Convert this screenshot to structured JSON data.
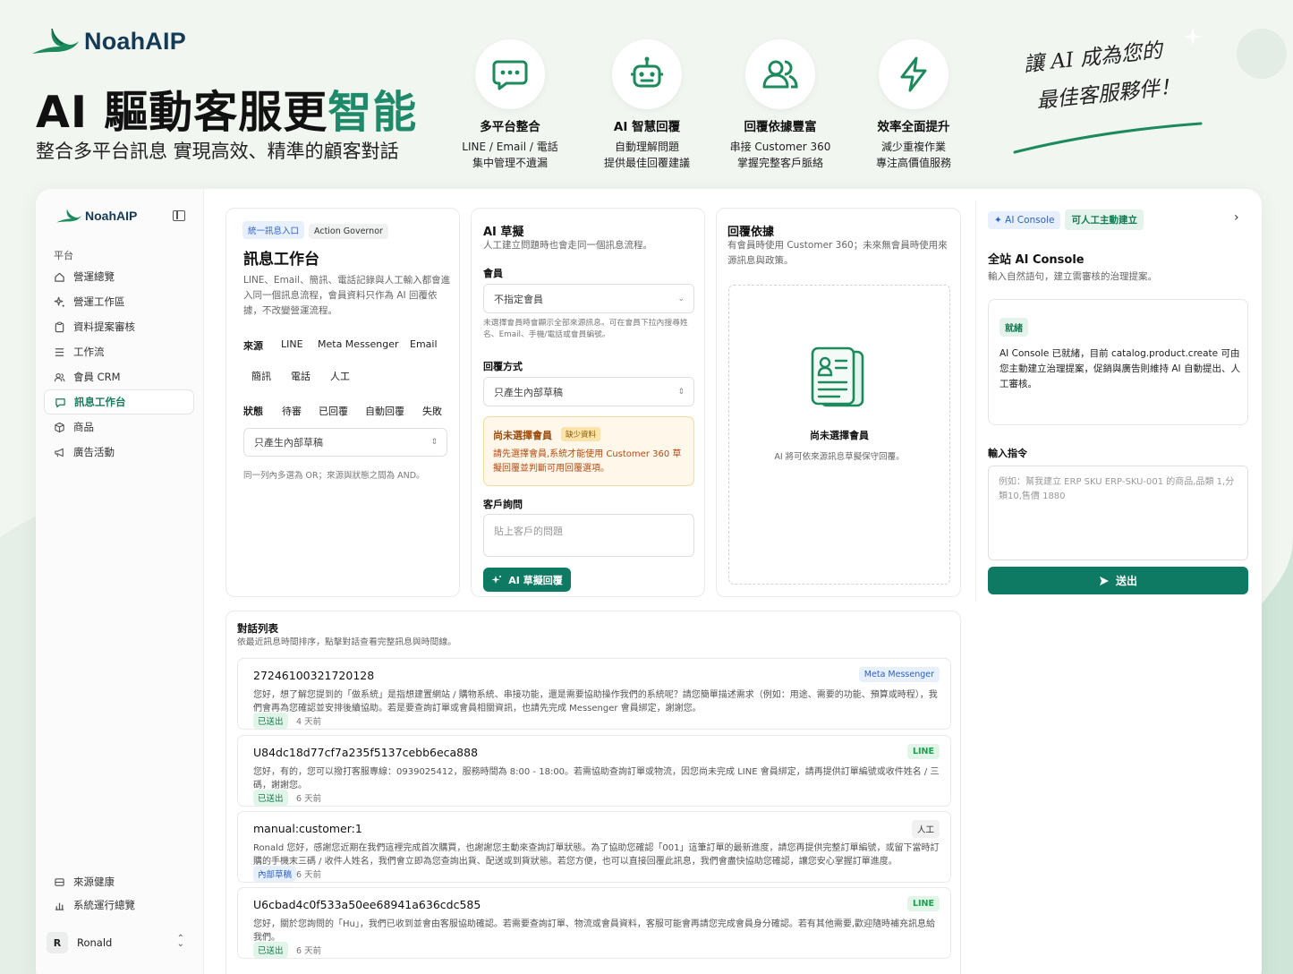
{
  "brand": {
    "logo_text": "NoahAIP"
  },
  "hero": {
    "headline_main": "AI 驅動客服更",
    "headline_accent": "智能",
    "subline": "整合多平台訊息 實現高效、精準的顧客對話",
    "tagline_line1": "讓 AI 成為您的",
    "tagline_line2": "最佳客服夥伴！",
    "features": [
      {
        "icon": "chat-bubble-icon",
        "title": "多平台整合",
        "line1": "LINE / Email / 電話",
        "line2": "集中管理不遺漏"
      },
      {
        "icon": "robot-icon",
        "title": "AI 智慧回覆",
        "line1": "自動理解問題",
        "line2": "提供最佳回覆建議"
      },
      {
        "icon": "users-icon",
        "title": "回覆依據豐富",
        "line1": "串接 Customer 360",
        "line2": "掌握完整客戶脈絡"
      },
      {
        "icon": "lightning-icon",
        "title": "效率全面提升",
        "line1": "減少重複作業",
        "line2": "專注高價值服務"
      }
    ]
  },
  "sidebar": {
    "logo_text": "NoahAIP",
    "section": "平台",
    "items": [
      {
        "label": "營運總覽",
        "icon": "home-icon"
      },
      {
        "label": "營運工作區",
        "icon": "sparkle-icon"
      },
      {
        "label": "資料提案審核",
        "icon": "clipboard-icon"
      },
      {
        "label": "工作流",
        "icon": "list-icon"
      },
      {
        "label": "會員 CRM",
        "icon": "users-icon"
      },
      {
        "label": "訊息工作台",
        "icon": "message-icon"
      },
      {
        "label": "商品",
        "icon": "box-icon"
      },
      {
        "label": "廣告活動",
        "icon": "megaphone-icon"
      }
    ],
    "active_index": 5,
    "bottom_items": [
      {
        "label": "來源健康",
        "icon": "database-icon"
      },
      {
        "label": "系統運行總覽",
        "icon": "bar-chart-icon"
      }
    ],
    "user": {
      "initial": "R",
      "name": "Ronald"
    }
  },
  "workbench": {
    "tag1": "統一訊息入口",
    "tag2": "Action Governor",
    "title": "訊息工作台",
    "desc": "LINE、Email、簡訊、電話記錄與人工輸入都會進入同一個訊息流程，會員資料只作為 AI 回覆依據，不改變營運流程。",
    "source_label": "來源",
    "sources": [
      "LINE",
      "Meta Messenger",
      "Email",
      "簡訊",
      "電話",
      "人工"
    ],
    "status_label": "狀態",
    "statuses": [
      "待審",
      "已回覆",
      "自動回覆",
      "失敗"
    ],
    "filter_value": "只產生內部草稿",
    "note": "同一列內多選為 OR；來源與狀態之間為 AND。"
  },
  "draft": {
    "title": "AI 草擬",
    "desc": "人工建立問題時也會走同一個訊息流程。",
    "member_label": "會員",
    "member_value": "不指定會員",
    "member_note": "未選擇會員時會顯示全部來源訊息。可在會員下拉內搜尋姓名、Email、手機/電話或會員編號。",
    "reply_label": "回覆方式",
    "reply_value": "只產生內部草稿",
    "warn_title": "尚未選擇會員",
    "warn_badge": "缺少資料",
    "warn_text": "請先選擇會員,系統才能使用 Customer 360 草擬回覆並判斷可用回覆選項。",
    "question_label": "客戶詢問",
    "question_placeholder": "貼上客戶的問題",
    "button": "AI 草擬回覆"
  },
  "basis": {
    "title": "回覆依據",
    "desc": "有會員時使用 Customer 360；未來無會員時使用來源訊息與政策。",
    "empty_title": "尚未選擇會員",
    "empty_desc": "AI 將可依來源訊息草擬保守回覆。"
  },
  "console": {
    "tag1": "AI Console",
    "tag2": "可人工主動建立",
    "title": "全站 AI Console",
    "desc": "輸入自然語句，建立需審核的治理提案。",
    "status": "就緒",
    "status_text": "AI Console 已就緒，目前 catalog.product.create 可由您主動建立治理提案，促銷與廣告則維持 AI 自動提出、人工審核。",
    "input_label": "輸入指令",
    "input_placeholder": "例如：幫我建立 ERP SKU ERP-SKU-001 的商品,品類 1,分類10,售價 1880",
    "send": "送出"
  },
  "conversations": {
    "title": "對話列表",
    "desc": "依最近訊息時間排序，點擊對話查看完整訊息與時間線。",
    "items": [
      {
        "id": "27246100321720128",
        "channel": "Meta Messenger",
        "channel_type": "meta",
        "message": "您好，想了解您提到的「做系統」是指想建置網站 / 購物系統、串接功能，還是需要協助操作我們的系統呢？請您簡單描述需求（例如：用途、需要的功能、預算或時程），我們會再為您確認並安排後續協助。若是要查詢訂單或會員相關資訊，也請先完成 Messenger 會員綁定，謝謝您。",
        "status": "已送出",
        "status_type": "sent",
        "ago": "4 天前"
      },
      {
        "id": "U84dc18d77cf7a235f5137cebb6eca888",
        "channel": "LINE",
        "channel_type": "line",
        "message": "您好，有的，您可以撥打客服專線：0939025412，服務時間為 8:00 - 18:00。若需協助查詢訂單或物流，因您尚未完成 LINE 會員綁定，請再提供訂單編號或收件姓名 / 三碼，謝謝您。",
        "status": "已送出",
        "status_type": "sent",
        "ago": "6 天前"
      },
      {
        "id": "manual:customer:1",
        "channel": "人工",
        "channel_type": "manual",
        "message": "Ronald 您好，感謝您近期在我們這裡完成首次購買，也謝謝您主動來查詢訂單狀態。為了協助您確認「001」這筆訂單的最新進度，請您再提供完整訂單編號，或留下當時訂購的手機末三碼 / 收件人姓名，我們會立即為您查詢出貨、配送或到貨狀態。若您方便，也可以直接回覆此訊息，我們會盡快協助您確認，讓您安心掌握訂單進度。",
        "status": "內部草稿",
        "status_type": "draft",
        "ago": "6 天前"
      },
      {
        "id": "U6cbad4c0f533a50ee68941a636cdc585",
        "channel": "LINE",
        "channel_type": "line",
        "message": "您好，關於您詢問的「Hu」，我們已收到並會由客服協助確認。若需要查詢訂單、物流或會員資料，客服可能會再請您完成會員身分確認。若有其他需要,歡迎隨時補充訊息給我們。",
        "status": "已送出",
        "status_type": "sent",
        "ago": "6 天前"
      }
    ]
  },
  "colors": {
    "brand": "#0f7a63",
    "accent": "#1f8a6a",
    "warn_bg": "#fff8ea"
  }
}
